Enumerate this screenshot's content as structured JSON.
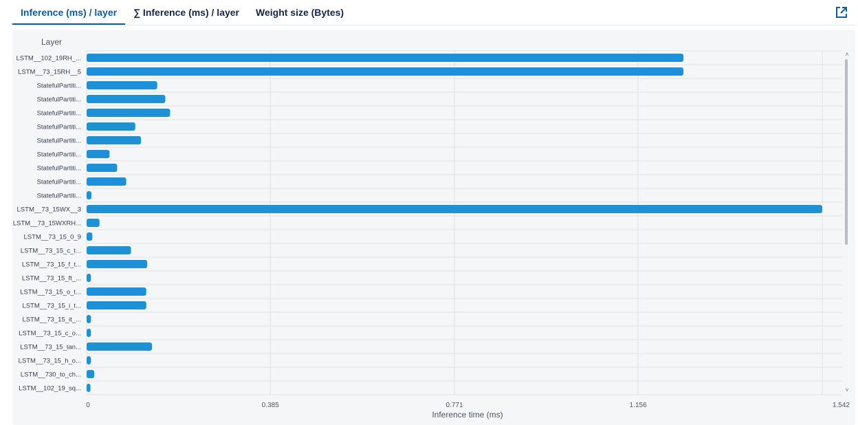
{
  "tabs": [
    {
      "label": "Inference (ms) / layer",
      "active": true
    },
    {
      "label": "∑ Inference (ms) / layer",
      "active": false
    },
    {
      "label": "Weight size (Bytes)",
      "active": false
    }
  ],
  "external_icon": "external-link-icon",
  "colors": {
    "bar": "#1e90d6",
    "active_tab": "#0b5cad",
    "panel": "#f5f6f7",
    "grid": "#dfe2e6"
  },
  "chart_data": {
    "type": "bar",
    "orientation": "horizontal",
    "title": "",
    "ylabel": "Layer",
    "xlabel": "Inference time (ms)",
    "xlim": [
      0,
      1.542
    ],
    "x_ticks": [
      "0",
      "0.385",
      "0.771",
      "1.156",
      "1.542"
    ],
    "x_tick_values": [
      0,
      0.385,
      0.771,
      1.156,
      1.542
    ],
    "grid": true,
    "categories": [
      "LSTM__102_19RH_...",
      "LSTM__73_15RH__5",
      "StatefulPartiti...",
      "StatefulPartiti...",
      "StatefulPartiti...",
      "StatefulPartiti...",
      "StatefulPartiti...",
      "StatefulPartiti...",
      "StatefulPartiti...",
      "StatefulPartiti...",
      "StatefulPartiti...",
      "LSTM__73_15WX__3",
      "LSTM__73_15WXRH...",
      "LSTM__73_15_0_9",
      "LSTM__73_15_c_t...",
      "LSTM__73_15_f_t...",
      "LSTM__73_15_ft_...",
      "LSTM__73_15_o_t...",
      "LSTM__73_15_i_t...",
      "LSTM__73_15_it_...",
      "LSTM__73_15_c_o...",
      "LSTM__73_15_tan...",
      "LSTM__73_15_h_o...",
      "LSTM__730_to_ch...",
      "LSTM__102_19_sq..."
    ],
    "values": [
      1.251,
      1.251,
      0.148,
      0.165,
      0.175,
      0.102,
      0.114,
      0.048,
      0.064,
      0.083,
      0.01,
      1.542,
      0.027,
      0.012,
      0.093,
      0.127,
      0.009,
      0.125,
      0.125,
      0.009,
      0.009,
      0.137,
      0.009,
      0.016,
      0.008
    ]
  }
}
